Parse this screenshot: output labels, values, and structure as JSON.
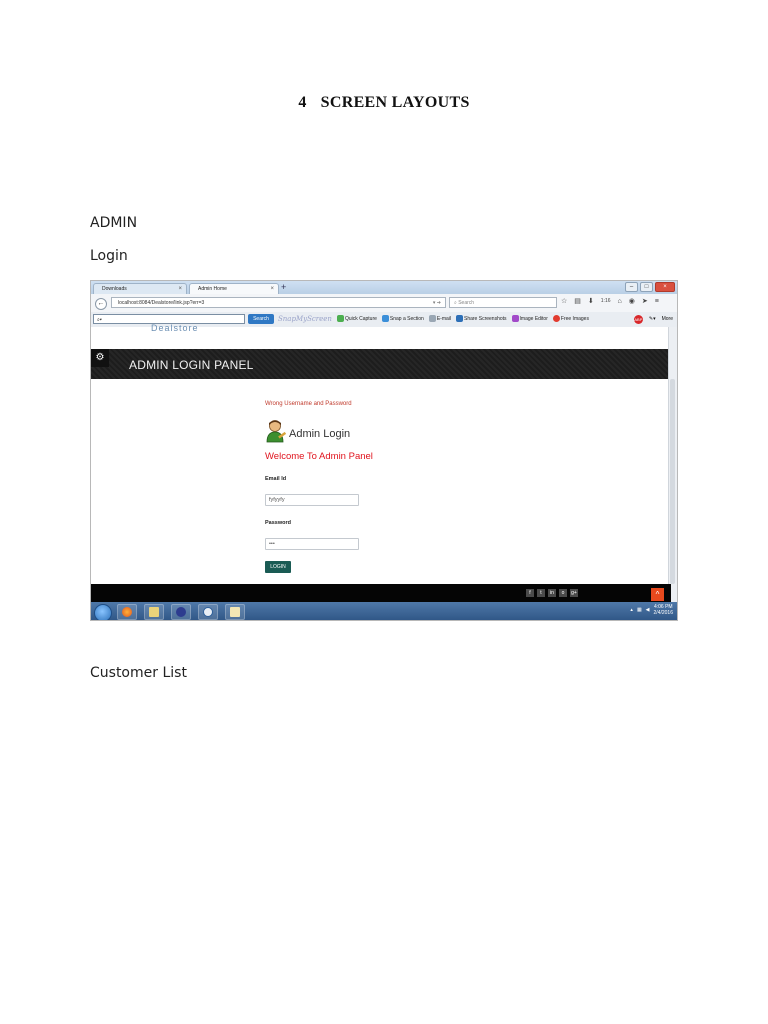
{
  "heading": {
    "number": "4",
    "title": "SCREEN LAYOUTS"
  },
  "labels": {
    "admin": "ADMIN",
    "login": "Login",
    "customer_list": "Customer List"
  },
  "screenshot": {
    "tabs": [
      {
        "label": "Downloads"
      },
      {
        "label": "Admin Home"
      }
    ],
    "url": "localhost:8084/Dealstore/link.jsp?err=3",
    "search_placeholder": "Search",
    "download_count": "1:16",
    "toolbar": {
      "search_button": "Search",
      "snapmyscreen": "SnapMyScreen",
      "quick_capture": "Quick Capture",
      "snap_section": "Snap a Section",
      "email": "E-mail",
      "share": "Share Screenshots",
      "image_editor": "Image Editor",
      "free_images": "Free Images",
      "more": "More"
    },
    "brand_peek": "Dealstore",
    "panel_title": "ADMIN LOGIN PANEL",
    "error_message": "Wrong Username and Password",
    "admin_login": "Admin Login",
    "welcome": "Welcome To Admin Panel",
    "email_label": "Email Id",
    "email_value": "fyfyyfy",
    "password_label": "Password",
    "password_value": "•••",
    "login_button": "LOGIN",
    "social": [
      "f",
      "t",
      "in",
      "o",
      "g+"
    ],
    "clock_time": "4:06 PM",
    "clock_date": "2/4/2016"
  },
  "colors": {
    "header": "#232323",
    "error": "#c0392b",
    "welcome": "#e0141e",
    "login_button": "#1a5b54",
    "to_top": "#e8491d"
  }
}
